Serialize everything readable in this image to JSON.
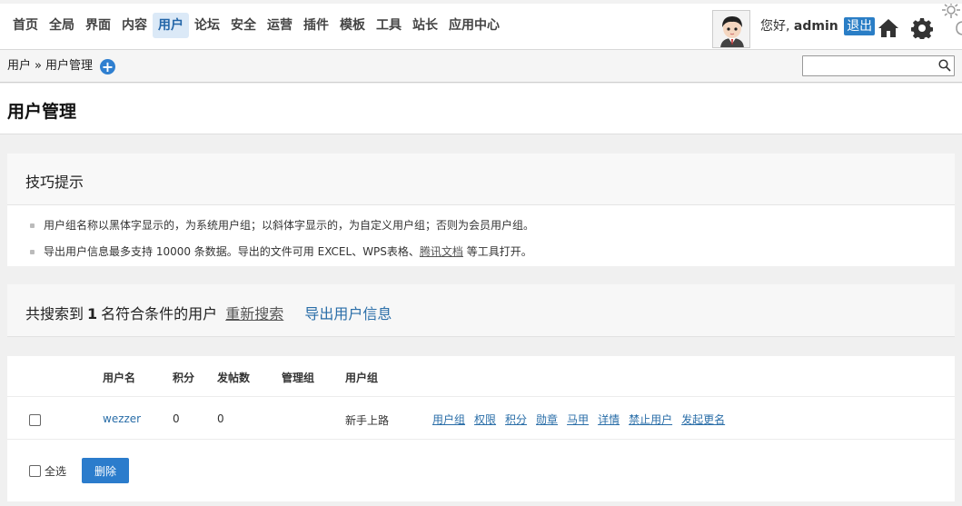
{
  "nav": {
    "items": [
      "首页",
      "全局",
      "界面",
      "内容",
      "用户",
      "论坛",
      "安全",
      "运营",
      "插件",
      "模板",
      "工具",
      "站长",
      "应用中心"
    ],
    "active_index": 4
  },
  "header": {
    "greeting": "您好,",
    "username": "admin",
    "logout_label": "退出"
  },
  "breadcrumb": {
    "parent": "用户",
    "separator": "»",
    "current": "用户管理"
  },
  "search": {
    "value": "",
    "placeholder": ""
  },
  "page_title": "用户管理",
  "tips": {
    "heading": "技巧提示",
    "item1": "用户组名称以黑体字显示的，为系统用户组；以斜体字显示的，为自定义用户组；否则为会员用户组。",
    "item2_before": "导出用户信息最多支持 10000 条数据。导出的文件可用 EXCEL、WPS表格、",
    "item2_link": "腾讯文档",
    "item2_after": "等工具打开。"
  },
  "result": {
    "prefix": "共搜索到",
    "count": "1",
    "suffix": "名符合条件的用户",
    "research_label": "重新搜索",
    "export_label": "导出用户信息"
  },
  "table": {
    "headers": [
      "用户名",
      "积分",
      "发帖数",
      "管理组",
      "用户组"
    ],
    "rows": [
      {
        "username": "wezzer",
        "credits": "0",
        "posts": "0",
        "admin_group": "",
        "user_group": "新手上路",
        "actions": [
          "用户组",
          "权限",
          "积分",
          "勋章",
          "马甲",
          "详情",
          "禁止用户",
          "发起更名"
        ]
      }
    ],
    "select_all_label": "全选",
    "delete_label": "删除"
  },
  "colors": {
    "accent": "#2a7ec6",
    "link": "#2a6ea8",
    "active_nav_bg": "#dbe9f7"
  }
}
